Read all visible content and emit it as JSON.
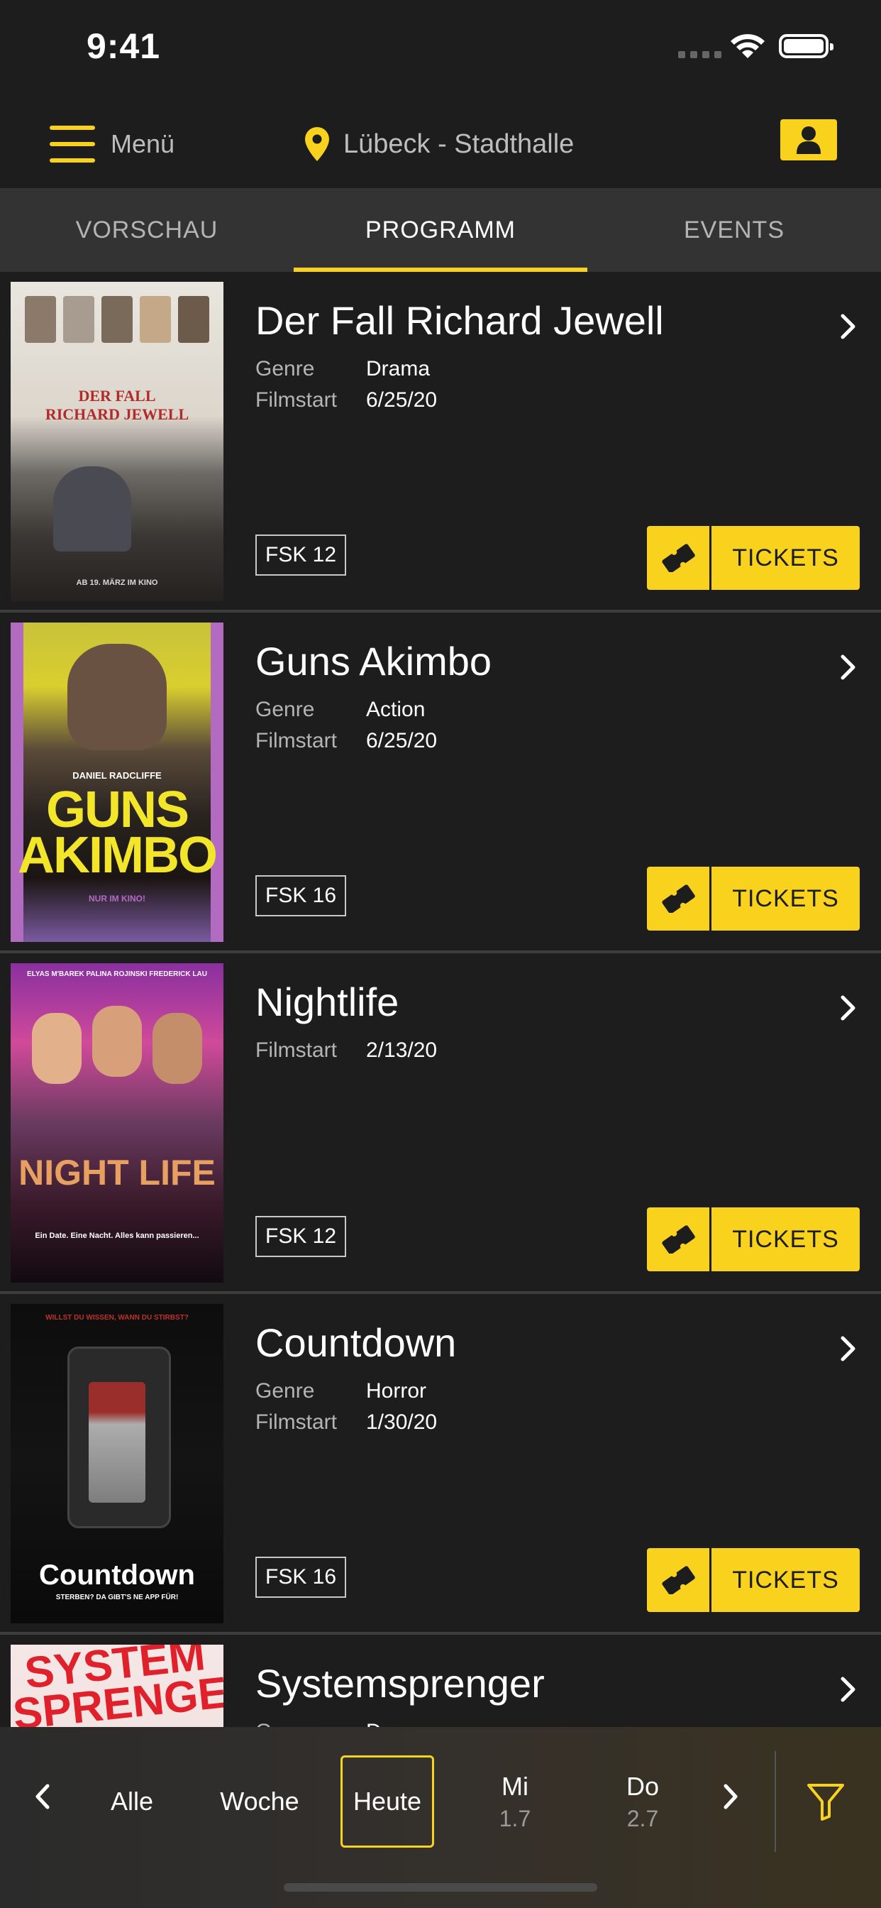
{
  "status": {
    "time": "9:41"
  },
  "nav": {
    "menu_label": "Menü",
    "location": "Lübeck - Stadthalle",
    "accent": "#f8d21c"
  },
  "tabs": [
    {
      "label": "VORSCHAU",
      "active": false
    },
    {
      "label": "PROGRAMM",
      "active": true
    },
    {
      "label": "EVENTS",
      "active": false
    }
  ],
  "labels": {
    "genre": "Genre",
    "filmstart": "Filmstart",
    "tickets": "TICKETS"
  },
  "movies": [
    {
      "title": "Der Fall Richard Jewell",
      "genre": "Drama",
      "filmstart": "6/25/20",
      "fsk": "FSK 12",
      "poster": {
        "top_text": "DER FALL",
        "main_text": "RICHARD JEWELL",
        "bottom_text": "AB 19. MÄRZ IM KINO"
      }
    },
    {
      "title": "Guns Akimbo",
      "genre": "Action",
      "filmstart": "6/25/20",
      "fsk": "FSK 16",
      "poster": {
        "top_text": "DANIEL RADCLIFFE",
        "main_text": "GUNS AKIMBO",
        "bottom_text": "NUR IM KINO!"
      }
    },
    {
      "title": "Nightlife",
      "filmstart": "2/13/20",
      "fsk": "FSK 12",
      "poster": {
        "top_text": "ELYAS M'BAREK  PALINA ROJINSKI  FREDERICK LAU",
        "main_text": "NIGHT LIFE",
        "bottom_text": "Ein Date. Eine Nacht. Alles kann passieren..."
      }
    },
    {
      "title": "Countdown",
      "genre": "Horror",
      "filmstart": "1/30/20",
      "fsk": "FSK 16",
      "poster": {
        "top_text": "WILLST DU WISSEN, WANN DU STIRBST?",
        "main_text": "Countdown",
        "bottom_text": "STERBEN? DA GIBT'S NE APP FÜR!"
      }
    },
    {
      "title": "Systemsprenger",
      "genre": "Drama",
      "poster": {
        "main_text": "SYSTEM SPRENGER"
      }
    }
  ],
  "bottom": {
    "items": [
      {
        "label": "Alle",
        "sub": ""
      },
      {
        "label": "Woche",
        "sub": ""
      },
      {
        "label": "Heute",
        "sub": "",
        "selected": true
      },
      {
        "label": "Mi",
        "sub": "1.7"
      },
      {
        "label": "Do",
        "sub": "2.7"
      }
    ]
  }
}
